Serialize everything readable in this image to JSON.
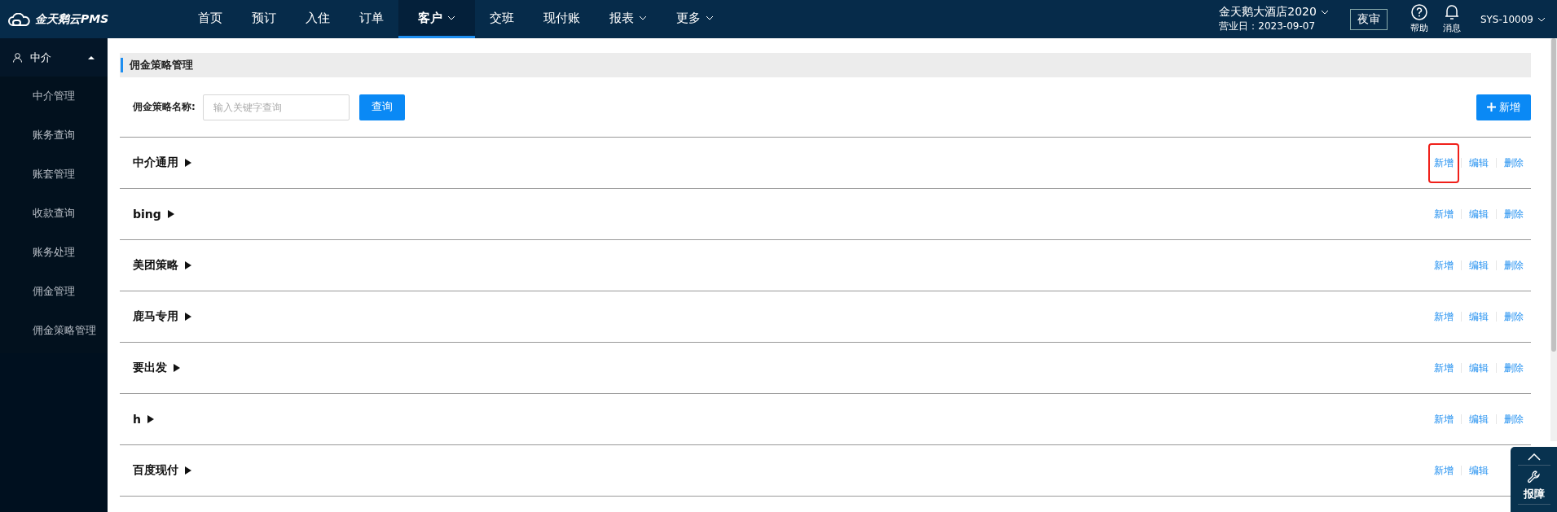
{
  "brand": {
    "name": "金天鹅云PMS"
  },
  "nav": [
    {
      "label": "首页",
      "selected": false,
      "has_menu": false
    },
    {
      "label": "预订",
      "selected": false,
      "has_menu": false
    },
    {
      "label": "入住",
      "selected": false,
      "has_menu": false
    },
    {
      "label": "订单",
      "selected": false,
      "has_menu": false
    },
    {
      "label": "客户",
      "selected": true,
      "has_menu": true
    },
    {
      "label": "交班",
      "selected": false,
      "has_menu": false
    },
    {
      "label": "现付账",
      "selected": false,
      "has_menu": false
    },
    {
      "label": "报表",
      "selected": false,
      "has_menu": true
    },
    {
      "label": "更多",
      "selected": false,
      "has_menu": true
    }
  ],
  "hotel": {
    "name": "金天鹅大酒店2020",
    "business_date": "营业日：2023-09-07"
  },
  "night_audit_button": "夜审",
  "tools": [
    {
      "label": "帮助",
      "kind": "help"
    },
    {
      "label": "消息",
      "kind": "bell"
    }
  ],
  "user": "SYS-10009",
  "sidebar": {
    "group": {
      "label": "中介",
      "expanded": true
    },
    "items": [
      {
        "label": "中介管理",
        "selected": false
      },
      {
        "label": "账务查询",
        "selected": false
      },
      {
        "label": "账套管理",
        "selected": false
      },
      {
        "label": "收款查询",
        "selected": false
      },
      {
        "label": "账务处理",
        "selected": false
      },
      {
        "label": "佣金管理",
        "selected": false
      },
      {
        "label": "佣金策略管理",
        "selected": false
      }
    ]
  },
  "page": {
    "title": "佣金策略管理",
    "search_label": "佣金策略名称:",
    "search_placeholder": "输入关键字查询",
    "search_button": "查询",
    "add_button": "新增"
  },
  "strategies": [
    {
      "name": "中介通用",
      "expanded": false,
      "actions": [
        {
          "label": "新增",
          "highlighted": true
        },
        {
          "label": "编辑",
          "highlighted": false
        },
        {
          "label": "删除",
          "highlighted": false
        }
      ]
    },
    {
      "name": "bing",
      "expanded": false,
      "actions": [
        {
          "label": "新增",
          "highlighted": false
        },
        {
          "label": "编辑",
          "highlighted": false
        },
        {
          "label": "删除",
          "highlighted": false
        }
      ]
    },
    {
      "name": "美团策略",
      "expanded": false,
      "actions": [
        {
          "label": "新增",
          "highlighted": false
        },
        {
          "label": "编辑",
          "highlighted": false
        },
        {
          "label": "删除",
          "highlighted": false
        }
      ]
    },
    {
      "name": "鹿马专用",
      "expanded": false,
      "actions": [
        {
          "label": "新增",
          "highlighted": false
        },
        {
          "label": "编辑",
          "highlighted": false
        },
        {
          "label": "删除",
          "highlighted": false
        }
      ]
    },
    {
      "name": "要出发",
      "expanded": false,
      "actions": [
        {
          "label": "新增",
          "highlighted": false
        },
        {
          "label": "编辑",
          "highlighted": false
        },
        {
          "label": "删除",
          "highlighted": false
        }
      ]
    },
    {
      "name": "h",
      "expanded": false,
      "actions": [
        {
          "label": "新增",
          "highlighted": false
        },
        {
          "label": "编辑",
          "highlighted": false
        },
        {
          "label": "删除",
          "highlighted": false
        }
      ]
    },
    {
      "name": "百度现付",
      "expanded": false,
      "actions": [
        {
          "label": "新增",
          "highlighted": false
        },
        {
          "label": "编辑",
          "highlighted": false
        }
      ]
    }
  ],
  "widget": {
    "label": "报障"
  }
}
